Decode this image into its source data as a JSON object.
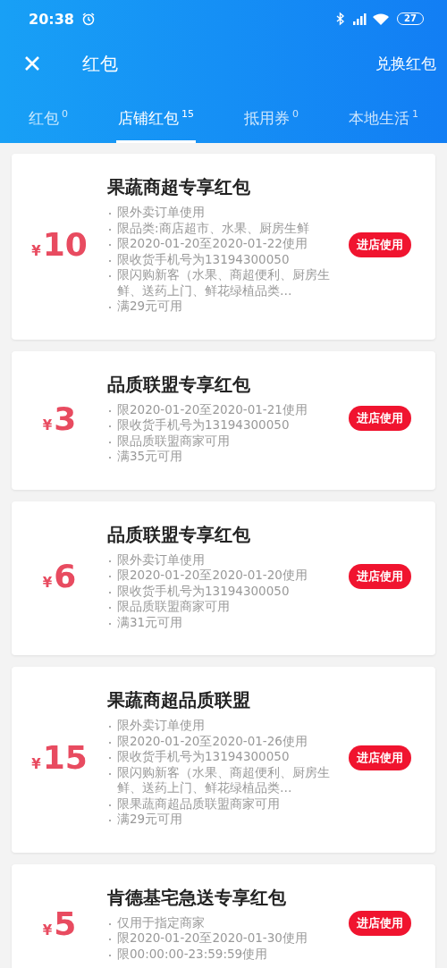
{
  "status_bar": {
    "time": "20:38",
    "battery": "27"
  },
  "header": {
    "title": "红包",
    "action": "兑换红包"
  },
  "tabs": [
    {
      "label": "红包",
      "count": "0",
      "selected": false
    },
    {
      "label": "店铺红包",
      "count": "15",
      "selected": true
    },
    {
      "label": "抵用券",
      "count": "0",
      "selected": false
    },
    {
      "label": "本地生活",
      "count": "1",
      "selected": false
    }
  ],
  "coupons": [
    {
      "currency": "¥",
      "amount": "10",
      "title": "果蔬商超专享红包",
      "rules": [
        "限外卖订单使用",
        "限品类:商店超市、水果、厨房生鲜",
        "限2020-01-20至2020-01-22使用",
        "限收货手机号为13194300050",
        "限闪购新客（水果、商超便利、厨房生鲜、送药上门、鲜花绿植品类…",
        "满29元可用"
      ],
      "button": "进店使用"
    },
    {
      "currency": "¥",
      "amount": "3",
      "title": "品质联盟专享红包",
      "rules": [
        "限2020-01-20至2020-01-21使用",
        "限收货手机号为13194300050",
        "限品质联盟商家可用",
        "满35元可用"
      ],
      "button": "进店使用"
    },
    {
      "currency": "¥",
      "amount": "6",
      "title": "品质联盟专享红包",
      "rules": [
        "限外卖订单使用",
        "限2020-01-20至2020-01-20使用",
        "限收货手机号为13194300050",
        "限品质联盟商家可用",
        "满31元可用"
      ],
      "button": "进店使用"
    },
    {
      "currency": "¥",
      "amount": "15",
      "title": "果蔬商超品质联盟",
      "rules": [
        "限外卖订单使用",
        "限2020-01-20至2020-01-26使用",
        "限收货手机号为13194300050",
        "限闪购新客（水果、商超便利、厨房生鲜、送药上门、鲜花绿植品类…",
        "限果蔬商超品质联盟商家可用",
        "满29元可用"
      ],
      "button": "进店使用"
    },
    {
      "currency": "¥",
      "amount": "5",
      "title": "肯德基宅急送专享红包",
      "rules": [
        "仅用于指定商家",
        "限2020-01-20至2020-01-30使用",
        "限00:00:00-23:59:59使用"
      ],
      "button": "进店使用"
    }
  ]
}
